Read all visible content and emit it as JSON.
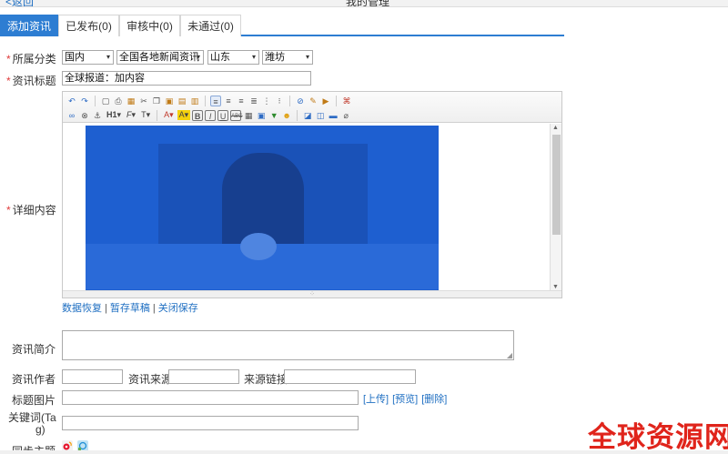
{
  "header": {
    "back_label": "<返回",
    "title": "我的管理"
  },
  "tabs": [
    {
      "label": "添加资讯",
      "active": true
    },
    {
      "label": "已发布(0)",
      "active": false
    },
    {
      "label": "审核中(0)",
      "active": false
    },
    {
      "label": "未通过(0)",
      "active": false
    }
  ],
  "form": {
    "category": {
      "label": "所属分类",
      "selects": [
        "国内",
        "全国各地新闻资讯",
        "山东",
        "潍坊"
      ]
    },
    "title": {
      "label": "资讯标题",
      "value": "全球报道：加内容"
    },
    "content": {
      "label": "详细内容"
    },
    "editor_links": {
      "restore": "数据恢复",
      "draft": "暂存草稿",
      "close_save": "关闭保存",
      "sep": "|"
    },
    "summary": {
      "label": "资讯简介",
      "value": ""
    },
    "author": {
      "label": "资讯作者",
      "value": ""
    },
    "source": {
      "label": "资讯来源",
      "value": ""
    },
    "source_link": {
      "label": "来源链接",
      "value": ""
    },
    "title_image": {
      "label": "标题图片",
      "value": "",
      "upload": "[上传]",
      "preview": "[预览]",
      "delete": "[删除]"
    },
    "keywords": {
      "label_line1": "关键词(Ta",
      "label_line2": "g)",
      "value": ""
    },
    "sync": {
      "label": "同步主题"
    }
  },
  "toolbar": {
    "heading_btn": "H1",
    "font_btn": "F",
    "size_btn": "T",
    "bold": "B",
    "italic": "I",
    "underline": "U",
    "strike": "ABC"
  },
  "watermark": "全球资源网",
  "colors": {
    "accent": "#2d7dd2",
    "link": "#1f6fc2",
    "required": "#e03b3b",
    "watermark": "#e0241b",
    "image_tint": "#1e5fd0"
  }
}
